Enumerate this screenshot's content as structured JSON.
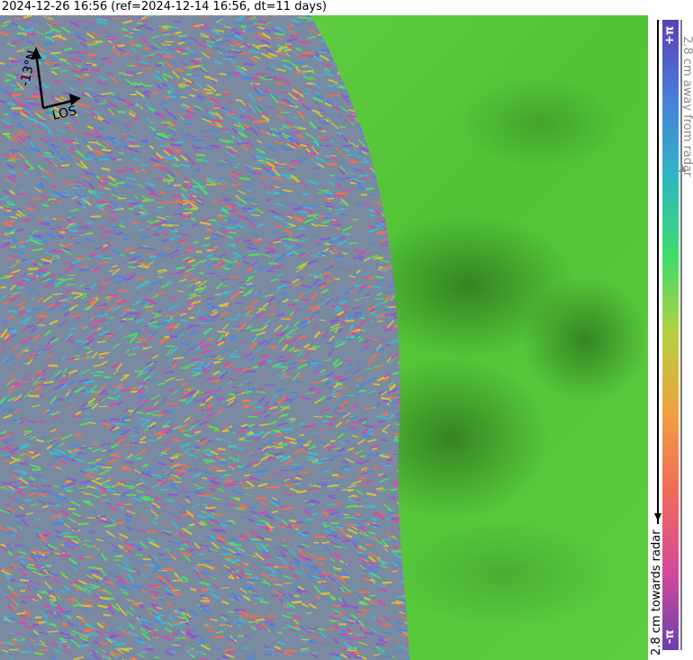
{
  "title": "2024-12-26 16:56 (ref=2024-12-14 16:56, dt=11 days)",
  "compass": {
    "north_label": "-13°N",
    "los_label": "LOS"
  },
  "colorbar": {
    "top_label": "+π",
    "bottom_label": "-π",
    "away_label": "2.8 cm away from radar",
    "towards_label": "2.8 cm towards radar",
    "colors": [
      "#5b3fb5",
      "#4a7ed8",
      "#2fb7c2",
      "#3fdc6a",
      "#b7d040",
      "#f0a040",
      "#f06a5a",
      "#d44a9a",
      "#6a3fb0"
    ]
  },
  "map": {
    "terrain_color": "#55c83a",
    "terrain_shadow_color": "#2e7a1e",
    "fringe_colors": [
      "#d94aa0",
      "#3fb8d0",
      "#58d860",
      "#d0c040",
      "#8a5ad0",
      "#f07050",
      "#4a88e0"
    ]
  }
}
